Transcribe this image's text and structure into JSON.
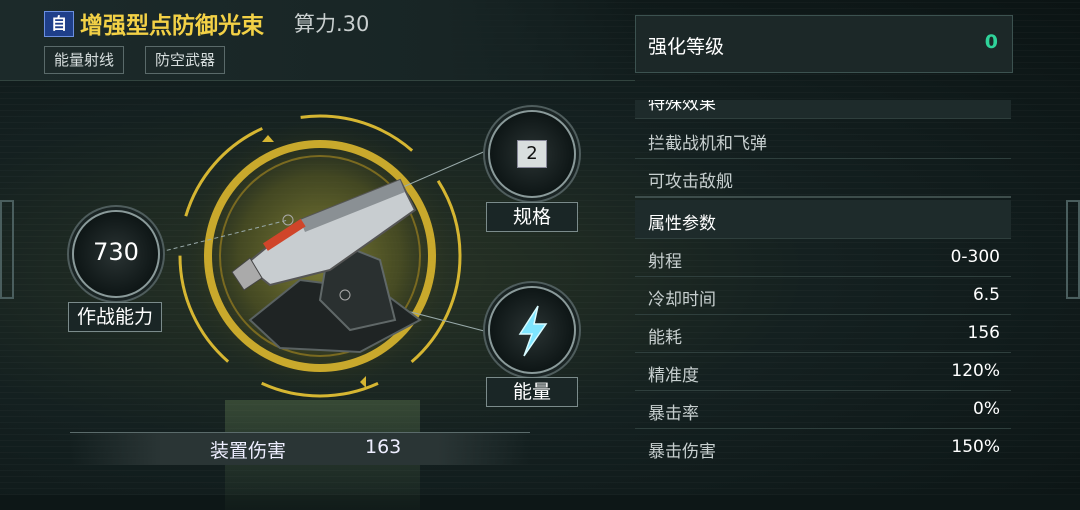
{
  "header": {
    "badge": "自",
    "title": "增强型点防御光束",
    "power": "算力.30",
    "tags": [
      "能量射线",
      "防空武器"
    ]
  },
  "stats_left": {
    "combat_value": "730",
    "combat_label": "作战能力",
    "spec_value": "2",
    "spec_label": "规格",
    "energy_label": "能量",
    "energy_icon": "lightning-icon"
  },
  "damage": {
    "label": "装置伤害",
    "value": "163"
  },
  "enhance": {
    "label": "强化等级",
    "value": "0"
  },
  "special": {
    "header": "特殊效果",
    "items": [
      "拦截战机和飞弹",
      "可攻击敌舰"
    ]
  },
  "attributes": {
    "header": "属性参数",
    "rows": [
      {
        "label": "射程",
        "value": "0-300"
      },
      {
        "label": "冷却时间",
        "value": "6.5"
      },
      {
        "label": "能耗",
        "value": "156"
      },
      {
        "label": "精准度",
        "value": "120%"
      },
      {
        "label": "暴击率",
        "value": "0%"
      },
      {
        "label": "暴击伤害",
        "value": "150%"
      }
    ]
  },
  "colors": {
    "title": "#f3d146",
    "enhance_value": "#2fd39a",
    "ring": "#d6b632"
  }
}
